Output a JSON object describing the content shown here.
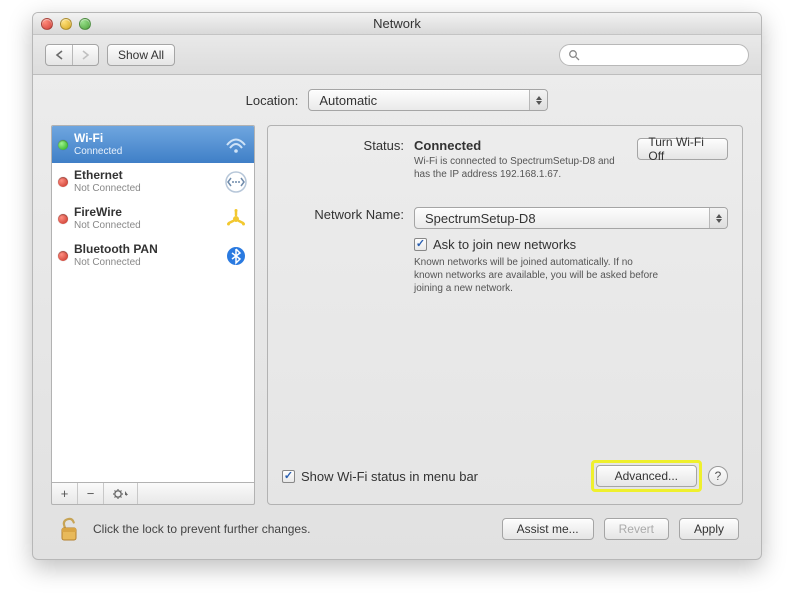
{
  "window": {
    "title": "Network"
  },
  "toolbar": {
    "show_all": "Show All",
    "search_placeholder": ""
  },
  "location": {
    "label": "Location:",
    "value": "Automatic"
  },
  "sidebar": {
    "services": [
      {
        "name": "Wi-Fi",
        "status": "Connected",
        "dot": "green"
      },
      {
        "name": "Ethernet",
        "status": "Not Connected",
        "dot": "red"
      },
      {
        "name": "FireWire",
        "status": "Not Connected",
        "dot": "red"
      },
      {
        "name": "Bluetooth PAN",
        "status": "Not Connected",
        "dot": "red"
      }
    ]
  },
  "panel": {
    "status_label": "Status:",
    "status_value": "Connected",
    "turn_off": "Turn Wi-Fi Off",
    "status_desc": "Wi-Fi is connected to SpectrumSetup-D8 and has the IP address 192.168.1.67.",
    "network_name_label": "Network Name:",
    "network_name_value": "SpectrumSetup-D8",
    "ask_join": "Ask to join new networks",
    "ask_join_desc": "Known networks will be joined automatically. If no known networks are available, you will be asked before joining a new network.",
    "show_menu": "Show Wi-Fi status in menu bar",
    "advanced": "Advanced...",
    "help": "?"
  },
  "footer": {
    "lock_text": "Click the lock to prevent further changes.",
    "assist": "Assist me...",
    "revert": "Revert",
    "apply": "Apply"
  }
}
